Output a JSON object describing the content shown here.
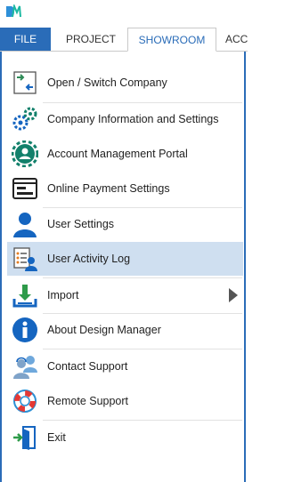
{
  "app": {
    "logo_icon": "designmanager-logo-icon"
  },
  "tabs": [
    {
      "label": "FILE",
      "active": true
    },
    {
      "label": "PROJECT"
    },
    {
      "label": "SHOWROOM"
    },
    {
      "label": "ACC"
    }
  ],
  "menu": {
    "items": [
      {
        "label": "Open / Switch Company",
        "icon": "open-switch-company-icon"
      },
      {
        "label": "Company Information and Settings",
        "icon": "company-settings-gears-icon"
      },
      {
        "label": "Account Management Portal",
        "icon": "account-portal-gear-user-icon"
      },
      {
        "label": "Online Payment Settings",
        "icon": "online-payment-window-icon"
      },
      {
        "label": "User Settings",
        "icon": "user-icon"
      },
      {
        "label": "User Activity Log",
        "icon": "activity-log-user-icon",
        "selected": true
      },
      {
        "label": "Import",
        "icon": "import-tray-icon",
        "has_submenu": true
      },
      {
        "label": "About Design Manager",
        "icon": "info-icon"
      },
      {
        "label": "Contact Support",
        "icon": "contact-support-users-icon"
      },
      {
        "label": "Remote Support",
        "icon": "lifebuoy-icon"
      },
      {
        "label": "Exit",
        "icon": "exit-door-icon"
      }
    ]
  },
  "colors": {
    "accent": "#2a6cb8",
    "selected_bg": "#cfdff0",
    "icon_blue": "#1565c0",
    "icon_teal": "#12806b"
  }
}
